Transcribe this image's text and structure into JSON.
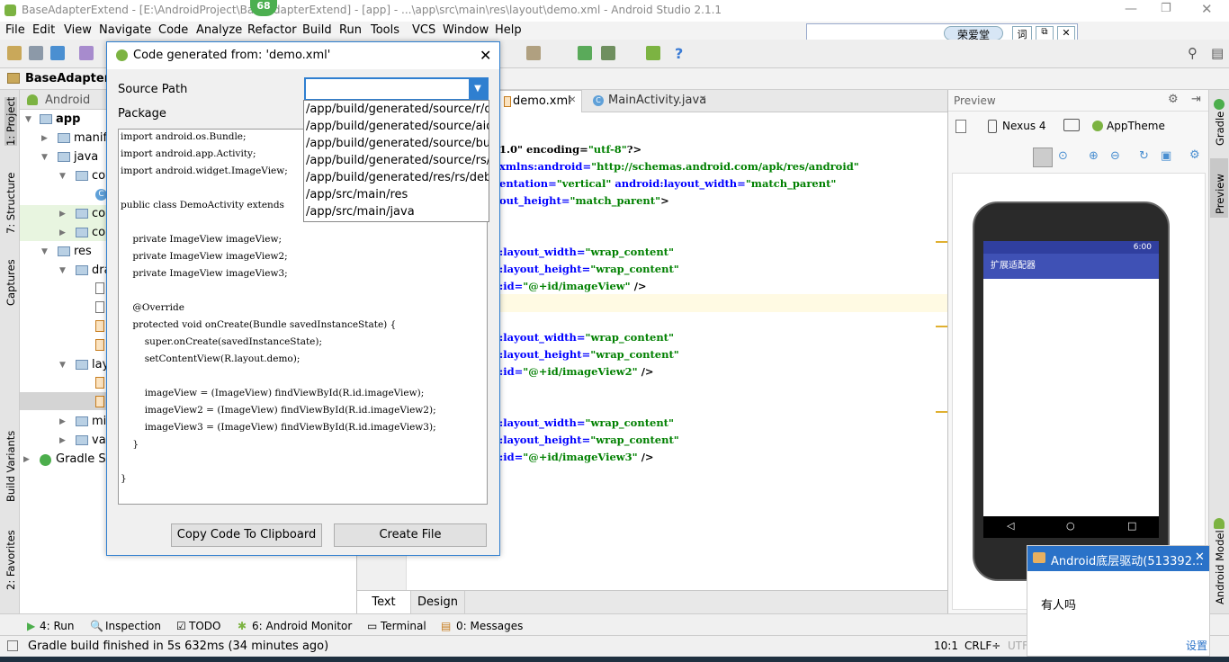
{
  "window": {
    "title": "BaseAdapterExtend - [E:\\AndroidProject\\BaseAdapterExtend] - [app] - ...\\app\\src\\main\\res\\layout\\demo.xml - Android Studio 2.1.1",
    "badge": "68"
  },
  "menu": [
    "File",
    "Edit",
    "View",
    "Navigate",
    "Code",
    "Analyze",
    "Refactor",
    "Build",
    "Run",
    "Tools",
    "VCS",
    "Window",
    "Help"
  ],
  "nav": {
    "project": "BaseAdapterEx"
  },
  "ime": {
    "name": "荣爱堂",
    "btn1": "词"
  },
  "left_strip": {
    "project": "1: Project",
    "structure": "7: Structure",
    "captures": "Captures",
    "build_variants": "Build Variants",
    "favorites": "2: Favorites"
  },
  "project_panel": {
    "view": "Android",
    "items": {
      "app": "app",
      "manifests": "manife",
      "java": "java",
      "co1": "co",
      "co2": "co",
      "co3": "co",
      "res": "res",
      "dra": "dra",
      "lay": "lay",
      "mi": "mi",
      "val": "val",
      "gradle": "Gradle Sc"
    }
  },
  "editor": {
    "tabs": [
      "demo.xml",
      "MainActivity.java"
    ],
    "bottom_tabs": [
      "Text",
      "Design"
    ],
    "lines": {
      "l1a": "1.0\" encoding=",
      "l1b": "\"utf-8\"",
      "l1c": "?>",
      "l2a": "xmlns:android=",
      "l2b": "\"http://schemas.android.com/apk/res/android\"",
      "l3a": "entation=",
      "l3b": "\"vertical\"",
      "l3c": " android:layout_width=",
      "l3d": "\"match_parent\"",
      "l4a": "out_height=",
      "l4b": "\"match_parent\"",
      "l4c": ">",
      "w1": ":layout_width=",
      "wv": "\"wrap_content\"",
      "h1": ":layout_height=",
      "i1": ":id=",
      "id1": "\"@+id/imageView\"",
      "id2": "\"@+id/imageView2\"",
      "id3": "\"@+id/imageView3\"",
      "close": " />"
    }
  },
  "preview": {
    "title": "Preview",
    "device": "Nexus 4",
    "theme": "AppTheme",
    "app_title": "扩展适配器",
    "time": "6:00"
  },
  "right_strip": {
    "gradle": "Gradle",
    "preview": "Preview",
    "android_model": "Android Model"
  },
  "dialog": {
    "title": "Code generated from: 'demo.xml'",
    "source_path_label": "Source Path",
    "package_label": "Package",
    "dropdown_options": [
      "/app/build/generated/source/r/debug",
      "/app/build/generated/source/aidl/debug",
      "/app/build/generated/source/buildConfig",
      "/app/build/generated/source/rs/debug",
      "/app/build/generated/res/rs/debug",
      "/app/src/main/res",
      "/app/src/main/java"
    ],
    "code_lines": [
      "import android.os.Bundle;",
      "import android.app.Activity;",
      "import android.widget.ImageView;",
      "",
      "public class DemoActivity extends",
      "",
      "",
      "    private ImageView imageView;",
      "    private ImageView imageView2;",
      "    private ImageView imageView3;",
      "",
      "    @Override",
      "    protected void onCreate(Bundle savedInstanceState) {",
      "        super.onCreate(savedInstanceState);",
      "        setContentView(R.layout.demo);",
      "",
      "        imageView = (ImageView) findViewById(R.id.imageView);",
      "        imageView2 = (ImageView) findViewById(R.id.imageView2);",
      "        imageView3 = (ImageView) findViewById(R.id.imageView3);",
      "    }",
      "",
      "}"
    ],
    "copy_button": "Copy Code To Clipboard",
    "create_button": "Create File"
  },
  "bottom_tools": {
    "run": "4: Run",
    "inspection": "Inspection",
    "todo": "TODO",
    "monitor": "6: Android Monitor",
    "terminal": "Terminal",
    "messages": "0: Messages"
  },
  "status": {
    "message": "Gradle build finished in 5s 632ms (34 minutes ago)",
    "position": "10:1",
    "line_sep": "CRLF÷",
    "encoding": "UTF"
  },
  "notification": {
    "title": "Android底层驱动(513392...",
    "message": "有人吗",
    "settings": "设置"
  },
  "colors": {
    "accent": "#3f51b5",
    "dialog_border": "#2f7fd0"
  }
}
